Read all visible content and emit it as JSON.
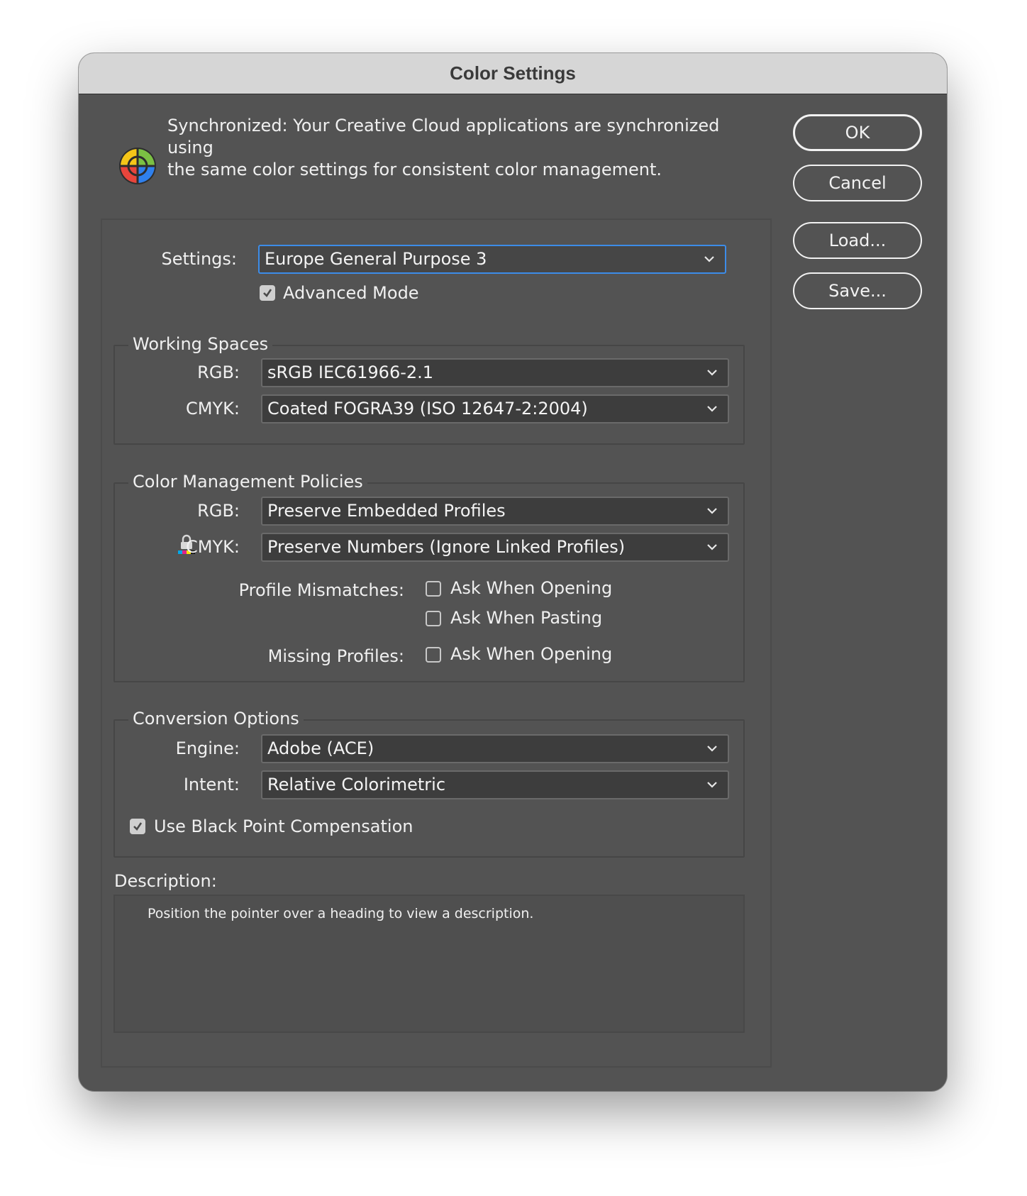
{
  "window": {
    "title": "Color Settings"
  },
  "sync": {
    "icon": "color-wheel-icon",
    "line1": "Synchronized: Your Creative Cloud applications are synchronized using",
    "line2": "the same color settings for consistent color management."
  },
  "buttons": {
    "ok": "OK",
    "cancel": "Cancel",
    "load": "Load...",
    "save": "Save..."
  },
  "settings": {
    "label": "Settings:",
    "value": "Europe General Purpose 3",
    "advanced_mode_label": "Advanced Mode",
    "advanced_mode_checked": true
  },
  "working_spaces": {
    "title": "Working Spaces",
    "rgb_label": "RGB:",
    "rgb_value": "sRGB IEC61966-2.1",
    "cmyk_label": "CMYK:",
    "cmyk_value": "Coated FOGRA39 (ISO 12647-2:2004)"
  },
  "policies": {
    "title": "Color Management Policies",
    "rgb_label": "RGB:",
    "rgb_value": "Preserve Embedded Profiles",
    "cmyk_label": "CMYK:",
    "cmyk_value": "Preserve Numbers (Ignore Linked Profiles)",
    "cmyk_icon": "lock-icon",
    "profile_mismatches_label": "Profile Mismatches:",
    "ask_when_opening": "Ask When Opening",
    "ask_when_opening_checked": false,
    "ask_when_pasting": "Ask When Pasting",
    "ask_when_pasting_checked": false,
    "missing_profiles_label": "Missing Profiles:",
    "missing_ask_when_opening": "Ask When Opening",
    "missing_ask_when_opening_checked": false
  },
  "conversion": {
    "title": "Conversion Options",
    "engine_label": "Engine:",
    "engine_value": "Adobe (ACE)",
    "intent_label": "Intent:",
    "intent_value": "Relative Colorimetric",
    "bpc_label": "Use Black Point Compensation",
    "bpc_checked": true
  },
  "description": {
    "label": "Description:",
    "text": "Position the pointer over a heading to view a description."
  }
}
